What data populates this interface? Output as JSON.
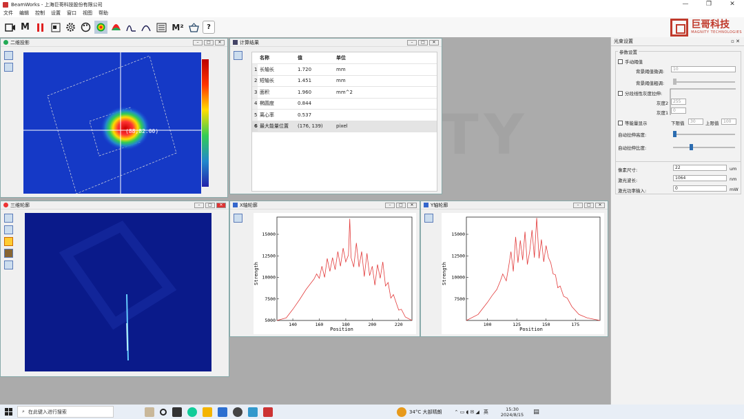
{
  "app": {
    "title": "BeamWorks - 上海巨哥科技股份有限公司"
  },
  "menu": [
    "文件",
    "编辑",
    "控制",
    "设置",
    "窗口",
    "视图",
    "帮助"
  ],
  "toolbar": {
    "m_label": "M",
    "m2_label": "M²",
    "help_label": "?"
  },
  "logo": {
    "cn": "巨哥科技",
    "en": "MAGNITY TECHNOLOGIES"
  },
  "win2d": {
    "title": "二维投影",
    "coords": "(88,82.00)"
  },
  "winRes": {
    "title": "计算结果",
    "headers": [
      "名称",
      "值",
      "单位"
    ],
    "rows": [
      [
        "1",
        "长轴长",
        "1.720",
        "mm"
      ],
      [
        "2",
        "短轴长",
        "1.451",
        "mm"
      ],
      [
        "3",
        "面积",
        "1.960",
        "mm^2"
      ],
      [
        "4",
        "椭圆度",
        "0.844",
        ""
      ],
      [
        "5",
        "离心率",
        "0.537",
        ""
      ],
      [
        "6",
        "最大能量位置",
        "(176, 139)",
        "pixel"
      ]
    ]
  },
  "win3d": {
    "title": "三维轮廓"
  },
  "winX": {
    "title": "X轴轮廓",
    "xlabel": "Position",
    "ylabel": "Strength"
  },
  "winY": {
    "title": "Y轴轮廓",
    "xlabel": "Position",
    "ylabel": "Strength"
  },
  "panel": {
    "title": "光束设置",
    "group": "参数设置",
    "manual": "手动阈值",
    "bg_fine": "背景阈值微调:",
    "bg_fine_val": "10",
    "bg_coarse": "背景阈值粗调:",
    "piecewise": "分段线性灰度拉伸:",
    "gray2": "灰度2",
    "gray2_val": "255",
    "gray1": "灰度1",
    "gray1_val": "0",
    "equal": "等能量显示",
    "lower": "下限值",
    "lower_val": "30",
    "upper": "上限值",
    "upper_val": "100",
    "auto_h": "自动拉伸高度:",
    "auto_r": "自动拉伸比度:",
    "pix": "像素尺寸:",
    "pix_val": "22",
    "pix_unit": "um",
    "wl": "激光波长:",
    "wl_val": "1064",
    "wl_unit": "nm",
    "pw": "激光功率输入:",
    "pw_val": "0",
    "pw_unit": "mW"
  },
  "taskbar": {
    "search": "在此键入进行搜索",
    "weather": "34°C 大部晴朗",
    "lang": "英",
    "time": "15:30",
    "date": "2024/8/15"
  },
  "chart_data": [
    {
      "type": "line",
      "title": "X轴轮廓",
      "xlabel": "Position",
      "ylabel": "Strength",
      "xlim": [
        128,
        230
      ],
      "ylim": [
        5000,
        17000
      ],
      "xticks": [
        140,
        160,
        180,
        200,
        220
      ],
      "yticks": [
        5000,
        7500,
        10000,
        12500,
        15000
      ],
      "series": [
        {
          "values": [
            [
              128,
              5000
            ],
            [
              135,
              5300
            ],
            [
              140,
              6300
            ],
            [
              145,
              7400
            ],
            [
              150,
              8600
            ],
            [
              153,
              9200
            ],
            [
              156,
              9800
            ],
            [
              158,
              10400
            ],
            [
              160,
              9900
            ],
            [
              162,
              11300
            ],
            [
              164,
              10000
            ],
            [
              166,
              12200
            ],
            [
              168,
              10700
            ],
            [
              170,
              12300
            ],
            [
              172,
              10900
            ],
            [
              174,
              13000
            ],
            [
              176,
              11300
            ],
            [
              178,
              13400
            ],
            [
              180,
              11800
            ],
            [
              182,
              12600
            ],
            [
              183,
              16800
            ],
            [
              184,
              12300
            ],
            [
              186,
              11200
            ],
            [
              188,
              14000
            ],
            [
              190,
              11200
            ],
            [
              192,
              13000
            ],
            [
              194,
              10100
            ],
            [
              196,
              12800
            ],
            [
              198,
              10200
            ],
            [
              200,
              11300
            ],
            [
              202,
              9100
            ],
            [
              204,
              11500
            ],
            [
              206,
              9900
            ],
            [
              208,
              11800
            ],
            [
              210,
              9000
            ],
            [
              212,
              9400
            ],
            [
              214,
              7600
            ],
            [
              216,
              8000
            ],
            [
              218,
              7100
            ],
            [
              220,
              6200
            ],
            [
              222,
              6300
            ],
            [
              225,
              5400
            ],
            [
              230,
              5000
            ]
          ]
        }
      ]
    },
    {
      "type": "line",
      "title": "Y轴轮廓",
      "xlabel": "Position",
      "ylabel": "Strength",
      "xlim": [
        82,
        196
      ],
      "ylim": [
        5000,
        17000
      ],
      "xticks": [
        100,
        125,
        150,
        175
      ],
      "yticks": [
        7500,
        10000,
        12500,
        15000
      ],
      "series": [
        {
          "values": [
            [
              82,
              5000
            ],
            [
              92,
              5700
            ],
            [
              100,
              7100
            ],
            [
              104,
              7900
            ],
            [
              108,
              8600
            ],
            [
              111,
              9600
            ],
            [
              113,
              10400
            ],
            [
              116,
              9600
            ],
            [
              118,
              11200
            ],
            [
              120,
              13000
            ],
            [
              122,
              10700
            ],
            [
              124,
              14700
            ],
            [
              126,
              11700
            ],
            [
              128,
              14300
            ],
            [
              130,
              12000
            ],
            [
              132,
              15300
            ],
            [
              134,
              11500
            ],
            [
              136,
              13000
            ],
            [
              138,
              15500
            ],
            [
              140,
              12300
            ],
            [
              142,
              16900
            ],
            [
              144,
              12200
            ],
            [
              146,
              14400
            ],
            [
              148,
              11800
            ],
            [
              150,
              13700
            ],
            [
              152,
              12300
            ],
            [
              154,
              11700
            ],
            [
              156,
              10400
            ],
            [
              158,
              10300
            ],
            [
              160,
              8800
            ],
            [
              162,
              9000
            ],
            [
              165,
              7800
            ],
            [
              168,
              7600
            ],
            [
              172,
              6600
            ],
            [
              178,
              5700
            ],
            [
              185,
              5300
            ],
            [
              196,
              5000
            ]
          ]
        }
      ]
    }
  ]
}
